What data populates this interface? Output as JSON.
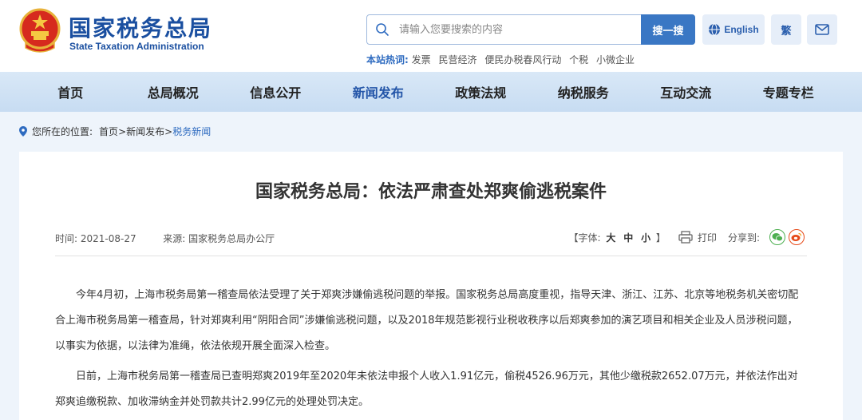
{
  "header": {
    "brand_cn": "国家税务总局",
    "brand_en": "State Taxation Administration",
    "search": {
      "placeholder": "请输入您要搜索的内容",
      "button_label": "搜一搜"
    },
    "hotwords": {
      "label": "本站热词:",
      "items": [
        "发票",
        "民营经济",
        "便民办税春风行动",
        "个税",
        "小微企业"
      ]
    },
    "english_label": "English",
    "traditional_label": "繁"
  },
  "nav": {
    "items": [
      {
        "label": "首页"
      },
      {
        "label": "总局概况"
      },
      {
        "label": "信息公开"
      },
      {
        "label": "新闻发布"
      },
      {
        "label": "政策法规"
      },
      {
        "label": "纳税服务"
      },
      {
        "label": "互动交流"
      },
      {
        "label": "专题专栏"
      }
    ],
    "active_index": 3
  },
  "breadcrumb": {
    "label": "您所在的位置:",
    "items": [
      "首页",
      "新闻发布",
      "税务新闻"
    ],
    "separator": ">"
  },
  "article": {
    "title": "国家税务总局：依法严肃查处郑爽偷逃税案件",
    "time_label": "时间: 2021-08-27",
    "source_label": "来源: 国家税务总局办公厅",
    "font_size_label": "【字体:",
    "font_size_options": [
      "大",
      "中",
      "小"
    ],
    "font_size_close": "】",
    "print_label": "打印",
    "share_label": "分享到:",
    "paragraphs": [
      "今年4月初，上海市税务局第一稽查局依法受理了关于郑爽涉嫌偷逃税问题的举报。国家税务总局高度重视，指导天津、浙江、江苏、北京等地税务机关密切配合上海市税务局第一稽查局，针对郑爽利用“阴阳合同”涉嫌偷逃税问题，以及2018年规范影视行业税收秩序以后郑爽参加的演艺项目和相关企业及人员涉税问题，以事实为依据，以法律为准绳，依法依规开展全面深入检查。",
      "日前，上海市税务局第一稽查局已查明郑爽2019年至2020年未依法申报个人收入1.91亿元，偷税4526.96万元，其他少缴税款2652.07万元，并依法作出对郑爽追缴税款、加收滞纳金并处罚款共计2.99亿元的处理处罚决定。"
    ]
  },
  "colors": {
    "brand_blue": "#1a4fa0",
    "accent_blue": "#3a77c4",
    "nav_bg": "#d9e8f7",
    "page_bg": "#eef4fb"
  }
}
